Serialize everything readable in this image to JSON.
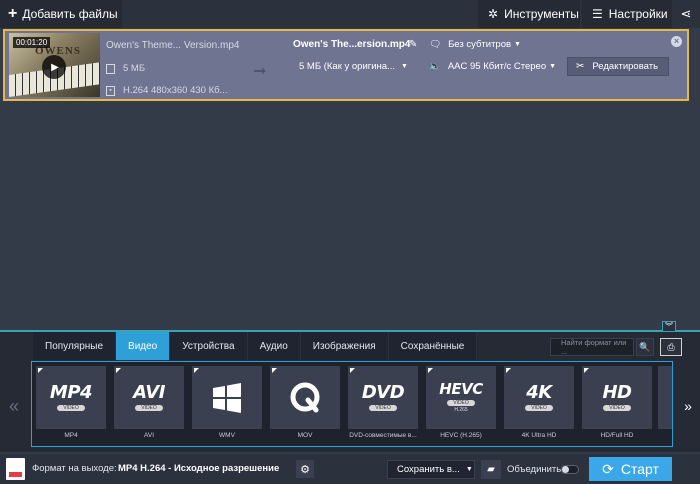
{
  "toolbar": {
    "add_files": "Добавить файлы",
    "tools": "Инструменты",
    "settings": "Настройки"
  },
  "file": {
    "thumb_time": "00:01:20",
    "thumb_caption": "OWENS",
    "source_name": "Owen's Theme... Version.mp4",
    "source_size": "5 МБ",
    "source_codec": "H.264 480x360 430 Кб...",
    "output_name": "Owen's The...ersion.mp4",
    "output_size": "5 МБ (Как у оригина...",
    "subtitles": "Без субтитров",
    "audio": "AAC 95 Кбит/с Стерео",
    "edit_label": "Редактировать"
  },
  "tabs": [
    {
      "label": "Популярные",
      "active": false
    },
    {
      "label": "Видео",
      "active": true
    },
    {
      "label": "Устройства",
      "active": false
    },
    {
      "label": "Аудио",
      "active": false
    },
    {
      "label": "Изображения",
      "active": false
    },
    {
      "label": "Сохранённые",
      "active": false
    }
  ],
  "search": {
    "placeholder": "Найти формат или ..."
  },
  "formats": [
    {
      "logo": "MP4",
      "sub": "VIDEO",
      "label": "MP4"
    },
    {
      "logo": "AVI",
      "sub": "VIDEO",
      "label": "AVI"
    },
    {
      "logo": "",
      "sub": "",
      "label": "WMV",
      "icon": "windows-logo-icon"
    },
    {
      "logo": "Q",
      "sub": "",
      "label": "MOV",
      "icon": "quicktime-logo-icon"
    },
    {
      "logo": "DVD",
      "sub": "VIDEO",
      "label": "DVD-совместимые в..."
    },
    {
      "logo": "HEVC",
      "sub": "VIDEO",
      "sub2": "H.265",
      "label": "HEVC (H.265)"
    },
    {
      "logo": "4K",
      "sub": "VIDEO",
      "label": "4K Ultra HD"
    },
    {
      "logo": "HD",
      "sub": "VIDEO",
      "label": "HD/Full HD"
    }
  ],
  "status": {
    "output_label": "Формат на выходе:",
    "output_value": "MP4 H.264 - Исходное разрешение",
    "save_label": "Сохранить в...",
    "merge_label": "Объединить",
    "start_label": "Старт"
  },
  "colors": {
    "accent": "#2f9fd8",
    "start": "#3aa7e8",
    "selection_border": "#e6b84a",
    "file_row_bg": "#6f7590"
  }
}
